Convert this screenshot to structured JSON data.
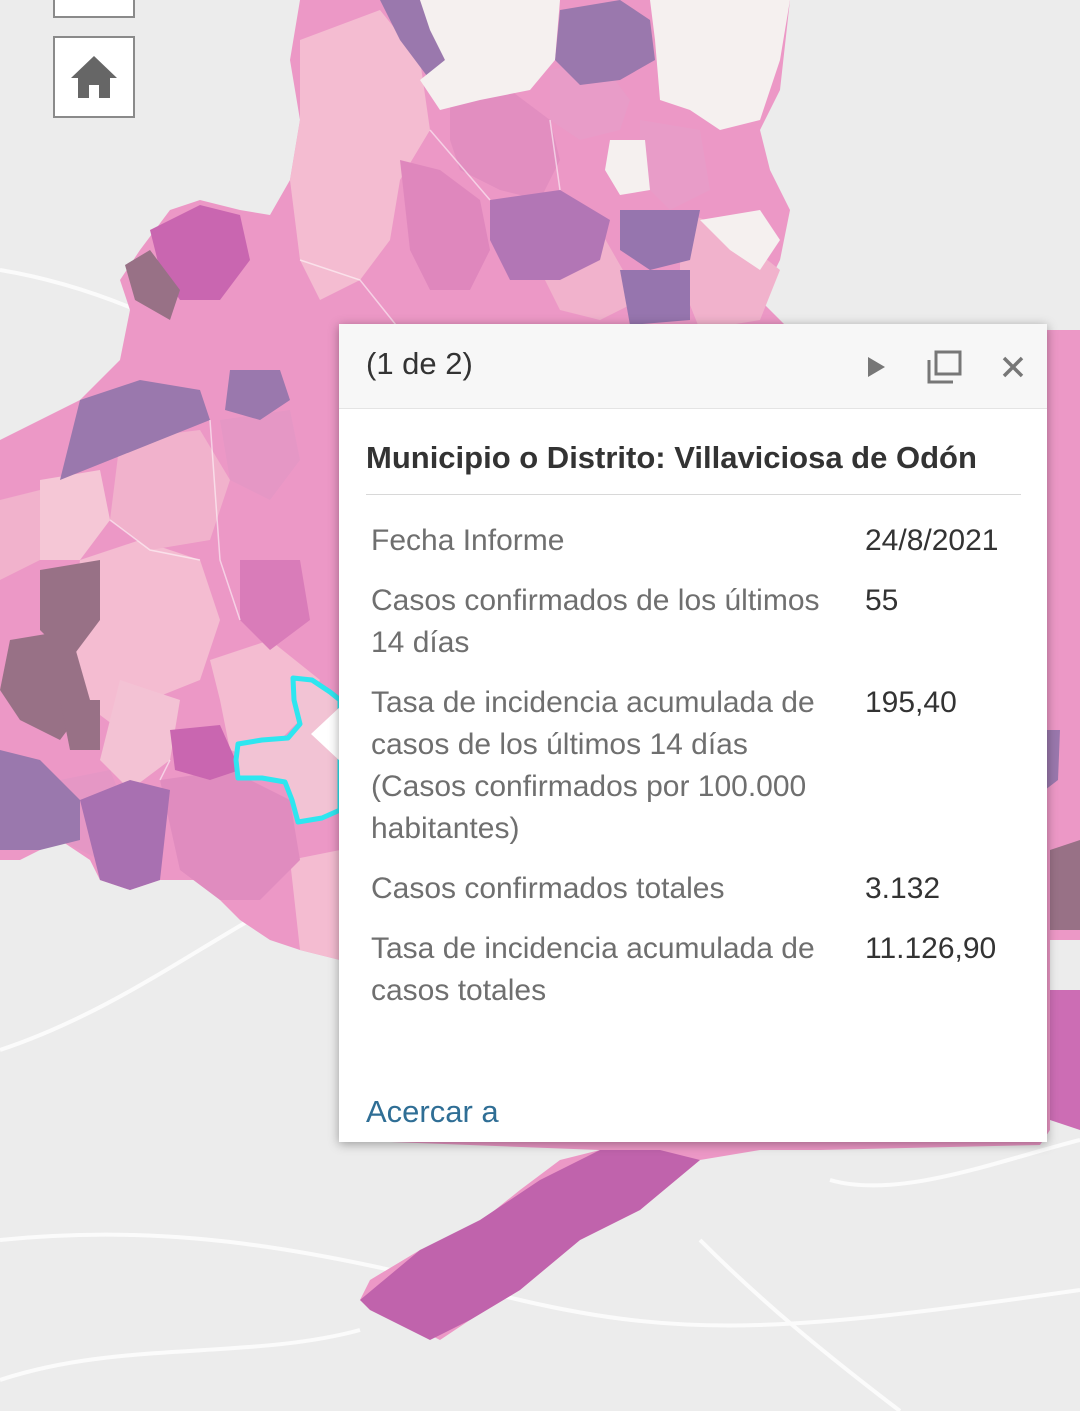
{
  "popup": {
    "count_label": "(1 de 2)",
    "title": "Municipio o Distrito: Villaviciosa de Odón",
    "fields": [
      {
        "label": "Fecha Informe",
        "value": "24/8/2021"
      },
      {
        "label": "Casos confirmados de los últimos 14 días",
        "value": "55"
      },
      {
        "label": "Tasa de incidencia acumulada de casos de los últimos 14 días (Casos confirmados por 100.000 habitantes)",
        "value": "195,40"
      },
      {
        "label": "Casos confirmados totales",
        "value": "3.132"
      },
      {
        "label": "Tasa de incidencia acumulada de casos totales",
        "value": "11.126,90"
      }
    ],
    "zoom_link": "Acercar a"
  },
  "icons": {
    "home": "home-icon",
    "play": "play-icon",
    "maximize": "maximize-icon",
    "close": "close-icon"
  },
  "colors": {
    "highlight": "#2ee6f0",
    "region_light": "#f2bfd2",
    "region_mid": "#e58fc0",
    "region_dark": "#b57bb8",
    "region_purple": "#9a78ad",
    "region_mauve": "#987186",
    "no_data": "#f3efee",
    "link": "#2f6e95"
  }
}
